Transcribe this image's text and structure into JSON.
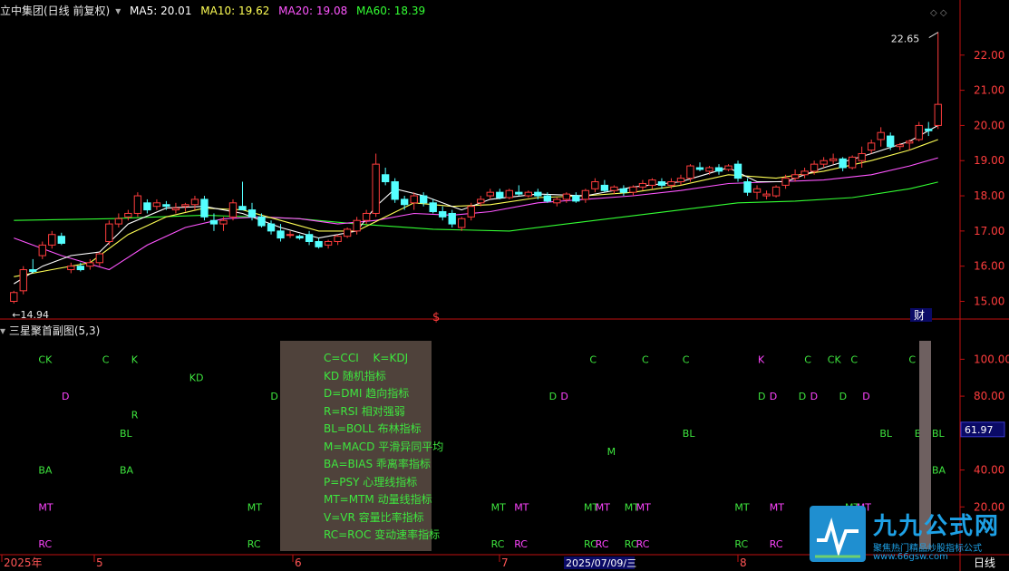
{
  "header": {
    "title": "立中集团(日线 前复权)",
    "ma5": "MA5: 20.01",
    "ma10": "MA10: 19.62",
    "ma20": "MA20: 19.08",
    "ma60": "MA60: 18.39"
  },
  "colors": {
    "up": "#ff3d3d",
    "down": "#54ffff",
    "ma5": "#ffffff",
    "ma10": "#ffff55",
    "ma20": "#ff55ff",
    "ma60": "#33ff33",
    "axis": "#c01010",
    "text_green": "#3ee63e",
    "text_magenta": "#ff44ff"
  },
  "chart_data": [
    {
      "type": "candlestick",
      "title": "立中集团(日线 前复权)",
      "ylim": [
        14.6,
        23.0
      ],
      "yticks": [
        "15.00",
        "16.00",
        "17.00",
        "18.00",
        "19.00",
        "20.00",
        "21.00",
        "22.00"
      ],
      "annotations": {
        "high": "22.65",
        "low": "14.94",
        "s_marker": "$",
        "fin_marker": "财"
      },
      "candles": [
        [
          15.0,
          15.3,
          14.94,
          15.25
        ],
        [
          15.3,
          16.0,
          15.2,
          15.9
        ],
        [
          15.9,
          16.2,
          15.8,
          15.85
        ],
        [
          16.3,
          16.7,
          16.2,
          16.6
        ],
        [
          16.6,
          17.0,
          16.5,
          16.9
        ],
        [
          16.85,
          16.95,
          16.6,
          16.65
        ],
        [
          15.9,
          16.1,
          15.8,
          16.0
        ],
        [
          16.0,
          16.1,
          15.85,
          15.9
        ],
        [
          16.0,
          16.2,
          15.9,
          16.1
        ],
        [
          16.1,
          16.4,
          16.0,
          16.35
        ],
        [
          16.7,
          17.3,
          16.6,
          17.2
        ],
        [
          17.2,
          17.5,
          17.1,
          17.35
        ],
        [
          17.4,
          17.6,
          17.3,
          17.5
        ],
        [
          17.5,
          18.1,
          17.4,
          18.0
        ],
        [
          17.8,
          17.9,
          17.5,
          17.6
        ],
        [
          17.7,
          17.9,
          17.6,
          17.8
        ],
        [
          17.75,
          17.85,
          17.6,
          17.7
        ],
        [
          17.6,
          17.8,
          17.5,
          17.65
        ],
        [
          17.7,
          17.8,
          17.55,
          17.75
        ],
        [
          17.75,
          18.0,
          17.6,
          17.9
        ],
        [
          17.9,
          18.0,
          17.3,
          17.4
        ],
        [
          17.3,
          17.5,
          17.0,
          17.2
        ],
        [
          17.2,
          17.4,
          17.0,
          17.3
        ],
        [
          17.4,
          17.9,
          17.3,
          17.8
        ],
        [
          17.7,
          18.4,
          17.6,
          17.6
        ],
        [
          17.6,
          17.8,
          17.3,
          17.4
        ],
        [
          17.4,
          17.5,
          17.1,
          17.15
        ],
        [
          17.2,
          17.3,
          16.9,
          17.0
        ],
        [
          17.0,
          17.2,
          16.7,
          16.8
        ],
        [
          16.9,
          17.0,
          16.8,
          16.9
        ],
        [
          16.85,
          16.9,
          16.75,
          16.8
        ],
        [
          16.9,
          17.0,
          16.6,
          16.7
        ],
        [
          16.7,
          16.8,
          16.5,
          16.55
        ],
        [
          16.6,
          16.75,
          16.5,
          16.7
        ],
        [
          16.7,
          16.9,
          16.6,
          16.85
        ],
        [
          16.85,
          17.1,
          16.8,
          17.05
        ],
        [
          17.0,
          17.4,
          16.9,
          17.3
        ],
        [
          17.3,
          17.6,
          17.2,
          17.5
        ],
        [
          17.5,
          19.2,
          17.4,
          18.9
        ],
        [
          18.6,
          18.8,
          18.3,
          18.4
        ],
        [
          18.4,
          18.5,
          17.8,
          17.9
        ],
        [
          17.9,
          18.0,
          17.6,
          17.75
        ],
        [
          17.8,
          18.1,
          17.6,
          18.0
        ],
        [
          18.0,
          18.1,
          17.7,
          17.8
        ],
        [
          17.8,
          17.9,
          17.5,
          17.55
        ],
        [
          17.55,
          17.7,
          17.3,
          17.4
        ],
        [
          17.5,
          17.6,
          17.1,
          17.2
        ],
        [
          17.1,
          17.4,
          17.0,
          17.35
        ],
        [
          17.4,
          17.8,
          17.3,
          17.7
        ],
        [
          17.8,
          18.0,
          17.7,
          17.9
        ],
        [
          18.0,
          18.2,
          17.9,
          18.1
        ],
        [
          18.1,
          18.2,
          17.9,
          17.95
        ],
        [
          17.95,
          18.2,
          17.9,
          18.15
        ],
        [
          18.1,
          18.3,
          18.0,
          18.05
        ],
        [
          18.0,
          18.15,
          17.95,
          18.1
        ],
        [
          18.1,
          18.2,
          17.9,
          18.0
        ],
        [
          18.0,
          18.1,
          17.8,
          17.85
        ],
        [
          17.8,
          17.95,
          17.7,
          17.9
        ],
        [
          17.9,
          18.1,
          17.8,
          18.05
        ],
        [
          18.0,
          18.1,
          17.8,
          17.85
        ],
        [
          17.9,
          18.2,
          17.8,
          18.15
        ],
        [
          18.2,
          18.5,
          18.1,
          18.4
        ],
        [
          18.3,
          18.45,
          18.1,
          18.15
        ],
        [
          18.15,
          18.3,
          18.05,
          18.25
        ],
        [
          18.2,
          18.3,
          18.0,
          18.1
        ],
        [
          18.1,
          18.3,
          18.0,
          18.25
        ],
        [
          18.25,
          18.45,
          18.15,
          18.35
        ],
        [
          18.3,
          18.5,
          18.2,
          18.45
        ],
        [
          18.4,
          18.5,
          18.2,
          18.3
        ],
        [
          18.3,
          18.5,
          18.2,
          18.4
        ],
        [
          18.4,
          18.6,
          18.3,
          18.5
        ],
        [
          18.5,
          18.9,
          18.4,
          18.85
        ],
        [
          18.8,
          18.95,
          18.7,
          18.75
        ],
        [
          18.7,
          18.85,
          18.6,
          18.8
        ],
        [
          18.8,
          18.9,
          18.6,
          18.7
        ],
        [
          18.75,
          18.9,
          18.7,
          18.85
        ],
        [
          18.9,
          19.0,
          18.4,
          18.5
        ],
        [
          18.4,
          18.5,
          18.0,
          18.1
        ],
        [
          18.1,
          18.3,
          17.9,
          18.2
        ],
        [
          18.0,
          18.15,
          17.9,
          18.05
        ],
        [
          18.0,
          18.3,
          17.95,
          18.25
        ],
        [
          18.3,
          18.6,
          18.2,
          18.5
        ],
        [
          18.5,
          18.75,
          18.4,
          18.6
        ],
        [
          18.6,
          18.8,
          18.5,
          18.7
        ],
        [
          18.7,
          19.0,
          18.6,
          18.9
        ],
        [
          18.9,
          19.1,
          18.8,
          19.0
        ],
        [
          19.0,
          19.2,
          18.9,
          19.05
        ],
        [
          19.05,
          19.1,
          18.7,
          18.8
        ],
        [
          18.8,
          19.15,
          18.75,
          19.1
        ],
        [
          19.0,
          19.4,
          18.8,
          19.2
        ],
        [
          19.3,
          19.6,
          19.2,
          19.5
        ],
        [
          19.6,
          19.95,
          19.4,
          19.8
        ],
        [
          19.7,
          19.8,
          19.3,
          19.4
        ],
        [
          19.4,
          19.5,
          19.3,
          19.45
        ],
        [
          19.5,
          19.6,
          19.3,
          19.55
        ],
        [
          19.6,
          20.1,
          19.55,
          20.0
        ],
        [
          19.9,
          20.1,
          19.7,
          19.85
        ],
        [
          20.0,
          22.65,
          19.9,
          20.6
        ]
      ],
      "ma5": [
        [
          0,
          15.5
        ],
        [
          3,
          16.0
        ],
        [
          6,
          16.3
        ],
        [
          9,
          16.4
        ],
        [
          12,
          17.2
        ],
        [
          16,
          17.65
        ],
        [
          20,
          17.7
        ],
        [
          24,
          17.5
        ],
        [
          28,
          17.1
        ],
        [
          32,
          16.8
        ],
        [
          36,
          17.0
        ],
        [
          38,
          17.7
        ],
        [
          40,
          18.2
        ],
        [
          43,
          18.0
        ],
        [
          47,
          17.6
        ],
        [
          50,
          17.9
        ],
        [
          55,
          18.05
        ],
        [
          60,
          18.0
        ],
        [
          65,
          18.25
        ],
        [
          70,
          18.4
        ],
        [
          75,
          18.8
        ],
        [
          78,
          18.4
        ],
        [
          81,
          18.4
        ],
        [
          85,
          18.8
        ],
        [
          90,
          19.2
        ],
        [
          94,
          19.55
        ],
        [
          97,
          20.0
        ]
      ],
      "ma10": [
        [
          0,
          15.7
        ],
        [
          4,
          15.9
        ],
        [
          8,
          16.1
        ],
        [
          12,
          16.9
        ],
        [
          16,
          17.4
        ],
        [
          20,
          17.65
        ],
        [
          24,
          17.6
        ],
        [
          28,
          17.3
        ],
        [
          32,
          17.0
        ],
        [
          36,
          17.0
        ],
        [
          39,
          17.4
        ],
        [
          42,
          17.8
        ],
        [
          46,
          17.7
        ],
        [
          50,
          17.75
        ],
        [
          55,
          17.95
        ],
        [
          60,
          18.0
        ],
        [
          65,
          18.1
        ],
        [
          70,
          18.3
        ],
        [
          75,
          18.6
        ],
        [
          80,
          18.5
        ],
        [
          85,
          18.7
        ],
        [
          90,
          19.0
        ],
        [
          94,
          19.3
        ],
        [
          97,
          19.6
        ]
      ],
      "ma20": [
        [
          0,
          16.8
        ],
        [
          5,
          16.3
        ],
        [
          10,
          15.9
        ],
        [
          14,
          16.6
        ],
        [
          18,
          17.1
        ],
        [
          22,
          17.35
        ],
        [
          26,
          17.4
        ],
        [
          30,
          17.35
        ],
        [
          34,
          17.2
        ],
        [
          38,
          17.3
        ],
        [
          42,
          17.5
        ],
        [
          46,
          17.45
        ],
        [
          50,
          17.55
        ],
        [
          55,
          17.8
        ],
        [
          60,
          17.9
        ],
        [
          65,
          18.0
        ],
        [
          70,
          18.15
        ],
        [
          75,
          18.35
        ],
        [
          80,
          18.4
        ],
        [
          85,
          18.45
        ],
        [
          90,
          18.6
        ],
        [
          94,
          18.85
        ],
        [
          97,
          19.08
        ]
      ],
      "ma60": [
        [
          0,
          17.3
        ],
        [
          10,
          17.35
        ],
        [
          20,
          17.45
        ],
        [
          30,
          17.35
        ],
        [
          36,
          17.2
        ],
        [
          44,
          17.05
        ],
        [
          52,
          17.0
        ],
        [
          58,
          17.2
        ],
        [
          64,
          17.4
        ],
        [
          70,
          17.6
        ],
        [
          76,
          17.8
        ],
        [
          82,
          17.85
        ],
        [
          88,
          17.95
        ],
        [
          94,
          18.2
        ],
        [
          97,
          18.39
        ]
      ]
    },
    {
      "type": "indicator-signals",
      "title": "三星聚首副图(5,3)",
      "ylim": [
        0,
        110
      ],
      "yticks": [
        "20.00",
        "40.00",
        "60.00",
        "80.00",
        "100.00"
      ],
      "current_value": "61.97",
      "signals": [
        {
          "t": "CK",
          "x": 6,
          "y": 100,
          "c": "g"
        },
        {
          "t": "C",
          "x": 17,
          "y": 100,
          "c": "g"
        },
        {
          "t": "K",
          "x": 22,
          "y": 100,
          "c": "g"
        },
        {
          "t": "KD",
          "x": 32,
          "y": 90,
          "c": "g"
        },
        {
          "t": "D",
          "x": 10,
          "y": 80,
          "c": "m"
        },
        {
          "t": "D",
          "x": 46,
          "y": 80,
          "c": "g"
        },
        {
          "t": "R",
          "x": 22,
          "y": 70,
          "c": "g"
        },
        {
          "t": "BL",
          "x": 20,
          "y": 60,
          "c": "g"
        },
        {
          "t": "BA",
          "x": 6,
          "y": 40,
          "c": "g"
        },
        {
          "t": "BA",
          "x": 20,
          "y": 40,
          "c": "g"
        },
        {
          "t": "MT",
          "x": 6,
          "y": 20,
          "c": "m"
        },
        {
          "t": "MT",
          "x": 42,
          "y": 20,
          "c": "g"
        },
        {
          "t": "RC",
          "x": 6,
          "y": 0,
          "c": "m"
        },
        {
          "t": "RC",
          "x": 42,
          "y": 0,
          "c": "g"
        },
        {
          "t": "C",
          "x": 101,
          "y": 100,
          "c": "g"
        },
        {
          "t": "C",
          "x": 110,
          "y": 100,
          "c": "g"
        },
        {
          "t": "C",
          "x": 117,
          "y": 100,
          "c": "g"
        },
        {
          "t": "K",
          "x": 130,
          "y": 100,
          "c": "m"
        },
        {
          "t": "C",
          "x": 138,
          "y": 100,
          "c": "g"
        },
        {
          "t": "CK",
          "x": 142,
          "y": 100,
          "c": "g"
        },
        {
          "t": "C",
          "x": 146,
          "y": 100,
          "c": "g"
        },
        {
          "t": "C",
          "x": 156,
          "y": 100,
          "c": "g"
        },
        {
          "t": "D",
          "x": 94,
          "y": 80,
          "c": "g"
        },
        {
          "t": "D",
          "x": 96,
          "y": 80,
          "c": "m"
        },
        {
          "t": "D",
          "x": 130,
          "y": 80,
          "c": "g"
        },
        {
          "t": "D",
          "x": 132,
          "y": 80,
          "c": "m"
        },
        {
          "t": "D",
          "x": 137,
          "y": 80,
          "c": "g"
        },
        {
          "t": "D",
          "x": 139,
          "y": 80,
          "c": "m"
        },
        {
          "t": "D",
          "x": 144,
          "y": 80,
          "c": "g"
        },
        {
          "t": "D",
          "x": 148,
          "y": 80,
          "c": "m"
        },
        {
          "t": "BL",
          "x": 117,
          "y": 60,
          "c": "g"
        },
        {
          "t": "BL",
          "x": 151,
          "y": 60,
          "c": "g"
        },
        {
          "t": "BL",
          "x": 157,
          "y": 60,
          "c": "g"
        },
        {
          "t": "BL",
          "x": 160,
          "y": 60,
          "c": "g"
        },
        {
          "t": "M",
          "x": 104,
          "y": 50,
          "c": "g"
        },
        {
          "t": "BA",
          "x": 160,
          "y": 40,
          "c": "g"
        },
        {
          "t": "MT",
          "x": 84,
          "y": 20,
          "c": "g"
        },
        {
          "t": "MT",
          "x": 88,
          "y": 20,
          "c": "m"
        },
        {
          "t": "MT",
          "x": 100,
          "y": 20,
          "c": "g"
        },
        {
          "t": "MT",
          "x": 102,
          "y": 20,
          "c": "m"
        },
        {
          "t": "MT",
          "x": 107,
          "y": 20,
          "c": "g"
        },
        {
          "t": "MT",
          "x": 109,
          "y": 20,
          "c": "m"
        },
        {
          "t": "MT",
          "x": 126,
          "y": 20,
          "c": "g"
        },
        {
          "t": "MT",
          "x": 132,
          "y": 20,
          "c": "m"
        },
        {
          "t": "MT",
          "x": 145,
          "y": 20,
          "c": "g"
        },
        {
          "t": "MT",
          "x": 147,
          "y": 20,
          "c": "m"
        },
        {
          "t": "RC",
          "x": 84,
          "y": 0,
          "c": "g"
        },
        {
          "t": "RC",
          "x": 88,
          "y": 0,
          "c": "m"
        },
        {
          "t": "RC",
          "x": 100,
          "y": 0,
          "c": "g"
        },
        {
          "t": "RC",
          "x": 102,
          "y": 0,
          "c": "m"
        },
        {
          "t": "RC",
          "x": 107,
          "y": 0,
          "c": "g"
        },
        {
          "t": "RC",
          "x": 109,
          "y": 0,
          "c": "m"
        },
        {
          "t": "RC",
          "x": 126,
          "y": 0,
          "c": "g"
        },
        {
          "t": "RC",
          "x": 132,
          "y": 0,
          "c": "m"
        },
        {
          "t": "RC",
          "x": 145,
          "y": 0,
          "c": "g"
        }
      ]
    }
  ],
  "legend": [
    "C=CCI　 K=KDJ",
    "KD 随机指标",
    "D=DMI 趋向指标",
    "R=RSI 相对强弱",
    "BL=BOLL 布林指标",
    "M=MACD 平滑异同平均",
    "BA=BIAS 乖离率指标",
    "P=PSY 心理线指标",
    "MT=MTM 动量线指标",
    "V=VR 容量比率指标",
    "RC=ROC 变动速率指标"
  ],
  "xaxis": {
    "labels": [
      "2025年",
      "5",
      "6",
      "7",
      "8"
    ],
    "cursor_date": "2025/07/09/三",
    "period": "日线"
  },
  "watermark": {
    "title": "九九公式网",
    "subtitle": "聚焦热门精品炒股指标公式",
    "url": "www.66gsw.com"
  }
}
